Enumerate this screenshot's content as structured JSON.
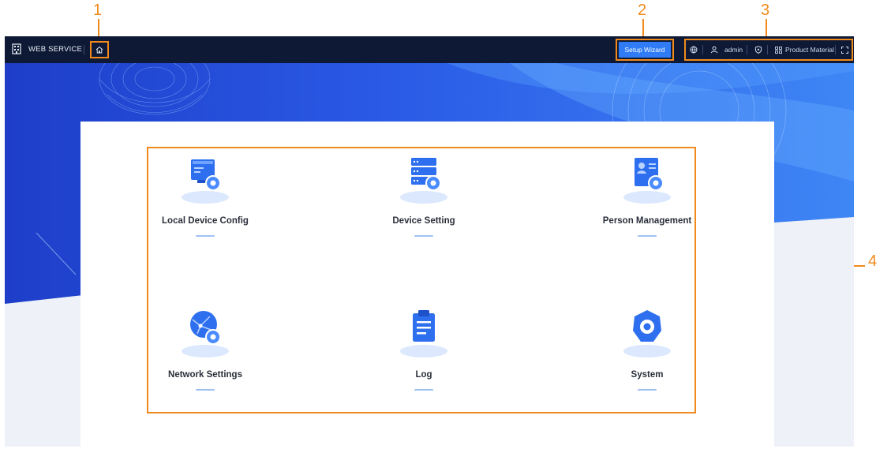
{
  "callouts": [
    "1",
    "2",
    "3",
    "4"
  ],
  "header": {
    "brand": "WEB SERVICE",
    "setup_wizard": "Setup Wizard",
    "user": "admin",
    "product_material": "Product Material"
  },
  "modules": [
    {
      "label": "Local Device Config",
      "icon": "monitor-gear-icon"
    },
    {
      "label": "Device Setting",
      "icon": "server-gear-icon"
    },
    {
      "label": "Person Management",
      "icon": "person-card-gear-icon"
    },
    {
      "label": "Network Settings",
      "icon": "globe-gear-icon"
    },
    {
      "label": "Log",
      "icon": "clipboard-icon"
    },
    {
      "label": "System",
      "icon": "hexagon-gear-icon"
    }
  ],
  "colors": {
    "topbar": "#0e1a35",
    "accent": "#2f7cf6",
    "callout": "#f08a1c",
    "banner_blue": "#2357e0"
  }
}
